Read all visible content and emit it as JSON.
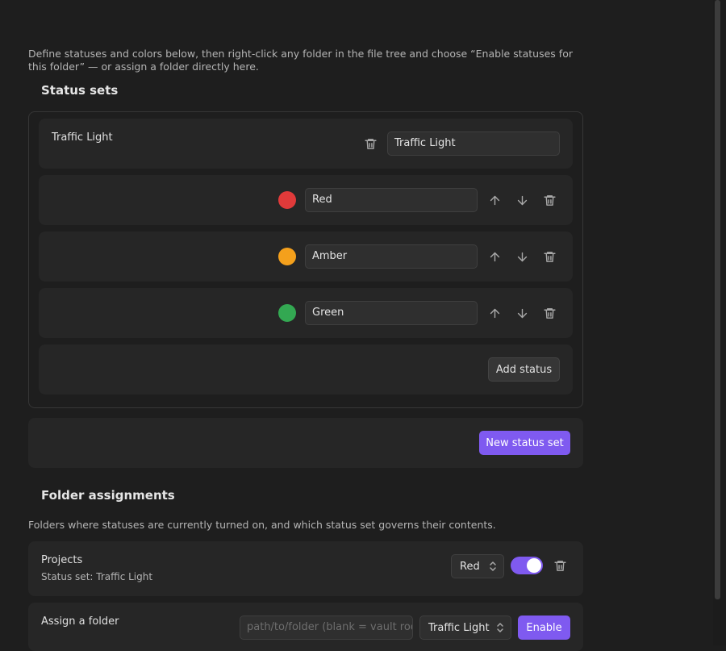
{
  "intro": "Define statuses and colors below, then right-click any folder in the file tree and choose “Enable statuses for this folder” — or assign a folder directly here.",
  "status_sets_heading": "Status sets",
  "status_set": {
    "label": "Traffic Light",
    "name_value": "Traffic Light",
    "statuses": [
      {
        "name": "Red",
        "color": "#e03a3a"
      },
      {
        "name": "Amber",
        "color": "#f4a01c"
      },
      {
        "name": "Green",
        "color": "#33a852"
      }
    ],
    "add_status_label": "Add status"
  },
  "new_status_set_label": "New status set",
  "folder_assignments_heading": "Folder assignments",
  "folder_assignments_desc": "Folders where statuses are currently turned on, and which status set governs their contents.",
  "assignment": {
    "folder": "Projects",
    "set_text": "Status set: Traffic Light",
    "selected_status": "Red",
    "enabled": true
  },
  "assign_folder": {
    "label": "Assign a folder",
    "path_placeholder": "path/to/folder (blank = vault root)",
    "selected_set": "Traffic Light",
    "enable_label": "Enable"
  },
  "icons": {
    "delete": "trash-icon",
    "up": "arrow-up-icon",
    "down": "arrow-down-icon",
    "select": "chevron-updown-icon"
  },
  "accent_color": "#7f5af0"
}
